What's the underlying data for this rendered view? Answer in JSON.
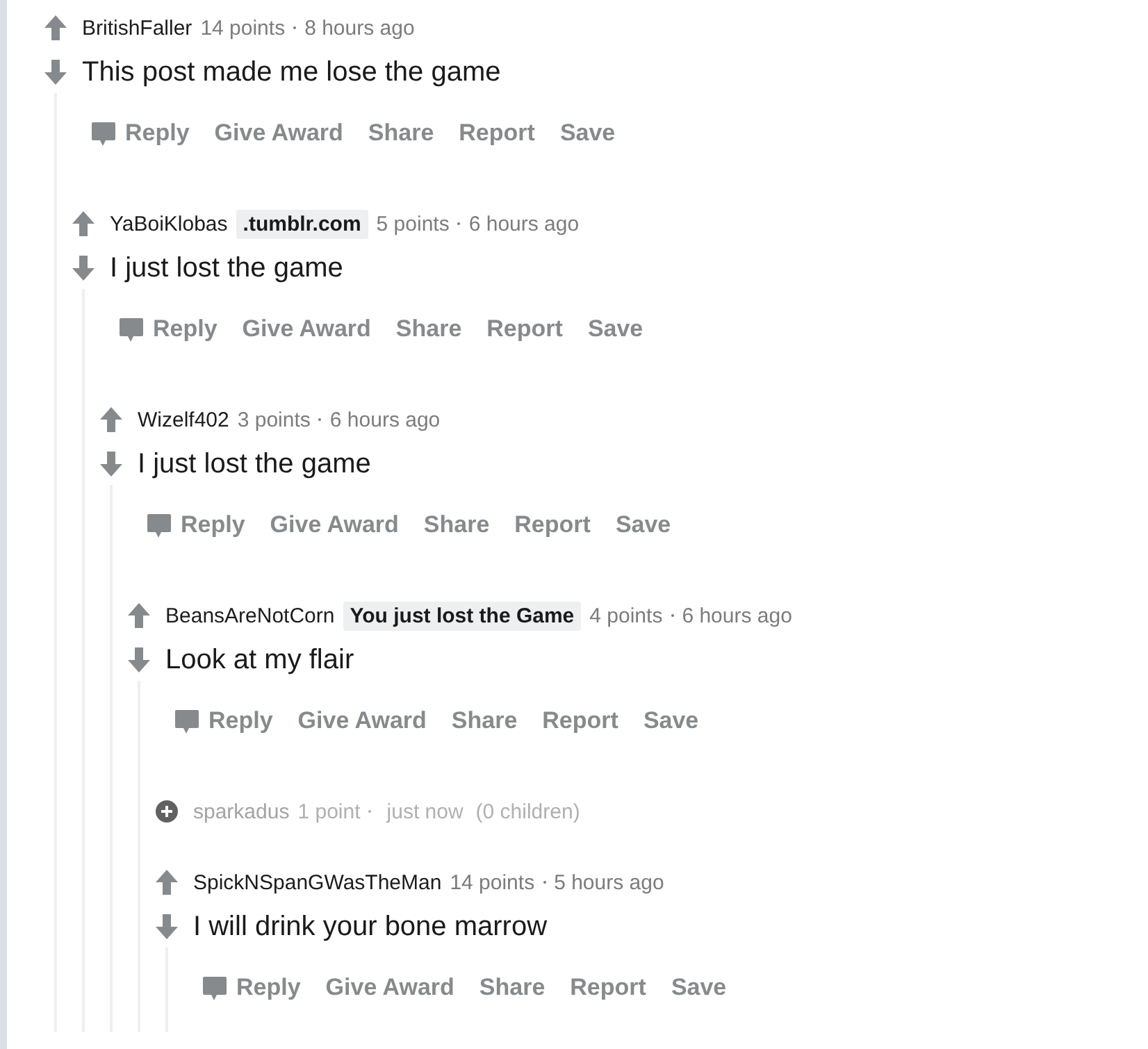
{
  "comments": [
    {
      "kind": "comment",
      "author": "BritishFaller",
      "points": "14 points",
      "time": "8 hours ago",
      "body": "This post made me lose the game",
      "actions": [
        "Reply",
        "Give Award",
        "Share",
        "Report",
        "Save"
      ],
      "children": [
        {
          "kind": "comment",
          "author": "YaBoiKlobas",
          "flair": ".tumblr.com",
          "points": "5 points",
          "time": "6 hours ago",
          "body": "I just lost the game",
          "actions": [
            "Reply",
            "Give Award",
            "Share",
            "Report",
            "Save"
          ],
          "children": [
            {
              "kind": "comment",
              "author": "Wizelf402",
              "points": "3 points",
              "time": "6 hours ago",
              "body": "I just lost the game",
              "actions": [
                "Reply",
                "Give Award",
                "Share",
                "Report",
                "Save"
              ],
              "children": [
                {
                  "kind": "comment",
                  "author": "BeansAreNotCorn",
                  "flair": "You just lost the Game",
                  "points": "4 points",
                  "time": "6 hours ago",
                  "body": "Look at my flair",
                  "actions": [
                    "Reply",
                    "Give Award",
                    "Share",
                    "Report",
                    "Save"
                  ],
                  "children": [
                    {
                      "kind": "collapsed",
                      "author": "sparkadus",
                      "points": "1 point",
                      "time": "just now",
                      "children_count": "(0 children)"
                    },
                    {
                      "kind": "comment",
                      "author": "SpickNSpanGWasTheMan",
                      "points": "14 points",
                      "time": "5 hours ago",
                      "body": "I will drink your bone marrow",
                      "actions": [
                        "Reply",
                        "Give Award",
                        "Share",
                        "Report",
                        "Save"
                      ]
                    }
                  ]
                }
              ]
            }
          ]
        }
      ]
    }
  ]
}
